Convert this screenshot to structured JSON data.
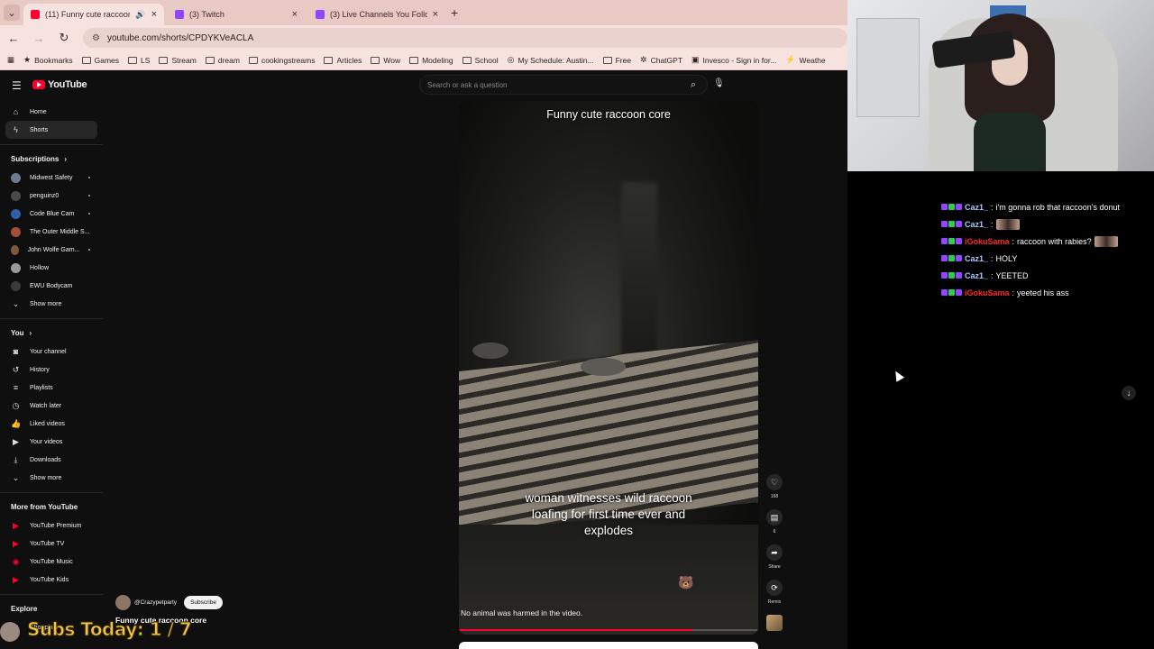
{
  "browser": {
    "tabs": [
      {
        "title": "(11) Funny cute raccoon co",
        "active": true,
        "favicon_color": "#ff0033"
      },
      {
        "title": "(3) Twitch",
        "active": false,
        "favicon_color": "#9146ff"
      },
      {
        "title": "(3) Live Channels You Follow - T",
        "active": false,
        "favicon_color": "#9146ff"
      }
    ],
    "url": "youtube.com/shorts/CPDYKVeACLA",
    "bookmarks": [
      "Bookmarks",
      "Games",
      "LS",
      "Stream",
      "dream",
      "cookingstreams",
      "Articles",
      "Wow",
      "Modeling",
      "School",
      "My Schedule: Austin...",
      "Free",
      "ChatGPT",
      "Invesco - Sign in for...",
      "Weathe"
    ]
  },
  "youtube": {
    "logo_text": "YouTube",
    "search_placeholder": "Search or ask a question",
    "nav": [
      {
        "label": "Home",
        "icon": "home-icon"
      },
      {
        "label": "Shorts",
        "icon": "shorts-icon",
        "active": true
      }
    ],
    "subscriptions_heading": "Subscriptions",
    "subscriptions": [
      {
        "label": "Midwest Safety",
        "color": "#6b7c8f"
      },
      {
        "label": "penguinz0",
        "color": "#4a4a4a"
      },
      {
        "label": "Code Blue Cam",
        "color": "#2f5fa8"
      },
      {
        "label": "The Outer Middle S...",
        "color": "#a0503a"
      },
      {
        "label": "John Wolfe Gam...",
        "color": "#7a5a3a"
      },
      {
        "label": "Hollow",
        "color": "#9a9a9a"
      },
      {
        "label": "EWU Bodycam",
        "color": "#3a3a3a"
      }
    ],
    "show_more": "Show more",
    "you_heading": "You",
    "you_items": [
      {
        "label": "Your channel",
        "icon": "account-icon"
      },
      {
        "label": "History",
        "icon": "history-icon"
      },
      {
        "label": "Playlists",
        "icon": "playlists-icon"
      },
      {
        "label": "Watch later",
        "icon": "clock-icon"
      },
      {
        "label": "Liked videos",
        "icon": "thumbs-up-icon"
      },
      {
        "label": "Your videos",
        "icon": "video-icon"
      },
      {
        "label": "Downloads",
        "icon": "download-icon"
      }
    ],
    "show_more_2": "Show more",
    "more_heading": "More from YouTube",
    "more_items": [
      "YouTube Premium",
      "YouTube TV",
      "YouTube Music",
      "YouTube Kids"
    ],
    "explore_heading": "Explore",
    "explore_items": [
      "Shopping"
    ],
    "short": {
      "title_overlay": "Funny cute raccoon core",
      "caption": "woman witnesses wild raccoon loafing for first time ever and explodes",
      "disclaimer": "No animal was harmed in the video.",
      "progress": 0.78,
      "channel": "@Crazypetparty",
      "subscribe_label": "Subscribe",
      "short_title": "Funny cute raccoon core",
      "likes": "168",
      "comments": "6",
      "share_label": "Share",
      "remix_label": "Remix"
    }
  },
  "overlay": {
    "subs_today": "Subs Today: 1 / 7"
  },
  "chat": {
    "messages": [
      {
        "user": "Caz1_",
        "user_color": "#a9c8ff",
        "text": "i'm gonna rob that raccoon's donut",
        "emote": false
      },
      {
        "user": "Caz1_",
        "user_color": "#a9c8ff",
        "text": "",
        "emote": true
      },
      {
        "user": "iGokuSama",
        "user_color": "#ff2a2a",
        "text": "raccoon with rabies?",
        "emote": true
      },
      {
        "user": "Caz1_",
        "user_color": "#a9c8ff",
        "text": "HOLY",
        "emote": false
      },
      {
        "user": "Caz1_",
        "user_color": "#a9c8ff",
        "text": "YEETED",
        "emote": false
      },
      {
        "user": "iGokuSama",
        "user_color": "#ff2a2a",
        "text": "yeeted his ass",
        "emote": false
      }
    ]
  }
}
